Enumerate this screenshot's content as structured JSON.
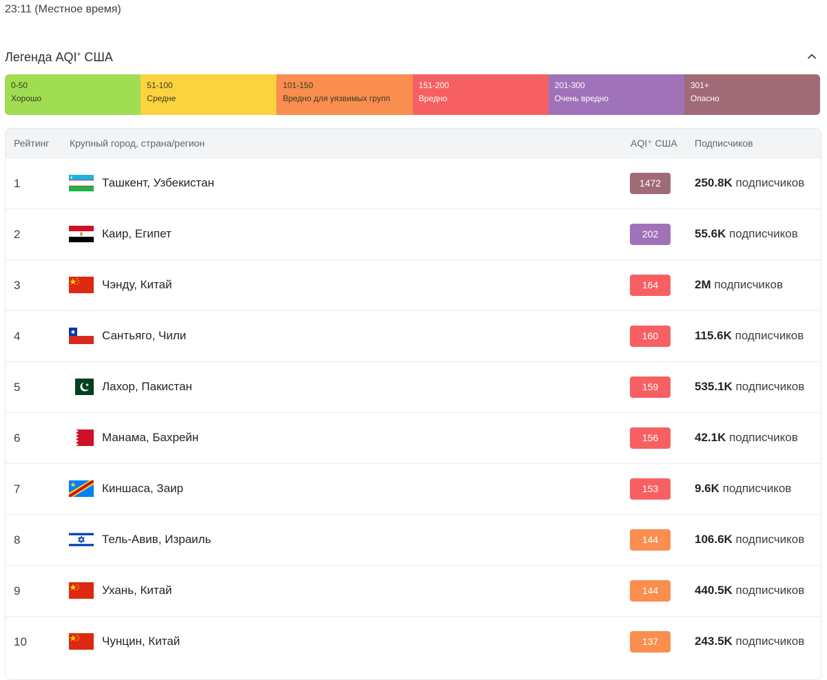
{
  "local_time": "23:11 (Местное время)",
  "legend": {
    "title_main": "Легенда AQI",
    "title_sup": "+",
    "title_tail": " США",
    "segments": [
      {
        "range": "0-50",
        "label": "Хорошо",
        "color": "#a0dd52"
      },
      {
        "range": "51-100",
        "label": "Средне",
        "color": "#fbd33f"
      },
      {
        "range": "101-150",
        "label": "Вредно для уязвимых групп",
        "color": "#f98e4f"
      },
      {
        "range": "151-200",
        "label": "Вредно",
        "color": "#f76063"
      },
      {
        "range": "201-300",
        "label": "Очень вредно",
        "color": "#a072b9"
      },
      {
        "range": "301+",
        "label": "Опасно",
        "color": "#a06a77"
      }
    ]
  },
  "table": {
    "headers": {
      "rank": "Рейтинг",
      "city": "Крупный город, страна/регион",
      "aqi": "AQI⁺ США",
      "subs": "Подписчиков"
    },
    "subs_suffix": " подписчиков",
    "rows": [
      {
        "rank": "1",
        "city": "Ташкент, Узбекистан",
        "flag": "uzbekistan",
        "aqi": "1472",
        "color": "#a06a77",
        "subs": "250.8K"
      },
      {
        "rank": "2",
        "city": "Каир, Египет",
        "flag": "egypt",
        "aqi": "202",
        "color": "#a072b9",
        "subs": "55.6K"
      },
      {
        "rank": "3",
        "city": "Чэнду, Китай",
        "flag": "china",
        "aqi": "164",
        "color": "#f76063",
        "subs": "2M"
      },
      {
        "rank": "4",
        "city": "Сантьяго, Чили",
        "flag": "chile",
        "aqi": "160",
        "color": "#f76063",
        "subs": "115.6K"
      },
      {
        "rank": "5",
        "city": "Лахор, Пакистан",
        "flag": "pakistan",
        "aqi": "159",
        "color": "#f76063",
        "subs": "535.1K"
      },
      {
        "rank": "6",
        "city": "Манама, Бахрейн",
        "flag": "bahrain",
        "aqi": "156",
        "color": "#f76063",
        "subs": "42.1K"
      },
      {
        "rank": "7",
        "city": "Киншаса, Заир",
        "flag": "drc",
        "aqi": "153",
        "color": "#f76063",
        "subs": "9.6K"
      },
      {
        "rank": "8",
        "city": "Тель-Авив, Израиль",
        "flag": "israel",
        "aqi": "144",
        "color": "#f98e4f",
        "subs": "106.6K"
      },
      {
        "rank": "9",
        "city": "Ухань, Китай",
        "flag": "china",
        "aqi": "144",
        "color": "#f98e4f",
        "subs": "440.5K"
      },
      {
        "rank": "10",
        "city": "Чунцин, Китай",
        "flag": "china",
        "aqi": "137",
        "color": "#f98e4f",
        "subs": "243.5K"
      }
    ]
  }
}
